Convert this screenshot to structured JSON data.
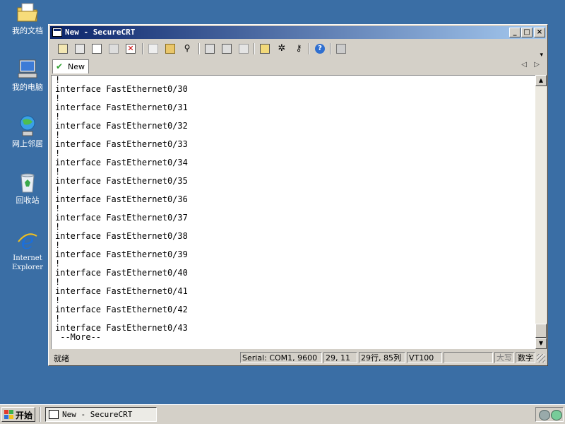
{
  "desktop": {
    "icons": [
      {
        "label": "我的文档",
        "icon": "folder-documents-icon"
      },
      {
        "label": "我的电脑",
        "icon": "computer-icon"
      },
      {
        "label": "网上邻居",
        "icon": "network-icon"
      },
      {
        "label": "回收站",
        "icon": "recycle-bin-icon"
      },
      {
        "label": "Internet Explorer",
        "icon": "internet-explorer-icon"
      }
    ]
  },
  "window": {
    "title": "New - SecureCRT",
    "caption_buttons": {
      "minimize": "_",
      "maximize": "□",
      "close": "×"
    },
    "toolbar_icons": [
      "connect-icon",
      "quick-connect-icon",
      "connect-in-tab-icon",
      "reconnect-icon",
      "disconnect-icon",
      "copy-icon",
      "paste-icon",
      "find-icon",
      "print-icon",
      "print-selection-icon",
      "print-screen-icon",
      "session-options-icon",
      "global-options-icon",
      "keymap-icon",
      "help-icon",
      "sftp-icon"
    ],
    "tab": {
      "label": "New",
      "status_icon": "checkmark-icon"
    },
    "terminal_lines": [
      "!",
      "interface FastEthernet0/30",
      "!",
      "interface FastEthernet0/31",
      "!",
      "interface FastEthernet0/32",
      "!",
      "interface FastEthernet0/33",
      "!",
      "interface FastEthernet0/34",
      "!",
      "interface FastEthernet0/35",
      "!",
      "interface FastEthernet0/36",
      "!",
      "interface FastEthernet0/37",
      "!",
      "interface FastEthernet0/38",
      "!",
      "interface FastEthernet0/39",
      "!",
      "interface FastEthernet0/40",
      "!",
      "interface FastEthernet0/41",
      "!",
      "interface FastEthernet0/42",
      "!",
      "interface FastEthernet0/43",
      " --More--"
    ],
    "status": {
      "state": "就绪",
      "connection": "Serial: COM1, 9600",
      "cursor": "29, 11",
      "size": "29行, 85列",
      "emulation": "VT100",
      "caps": "大写",
      "num": "数字"
    }
  },
  "taskbar": {
    "start_label": "开始",
    "task_title": "New - SecureCRT",
    "tray_icons": [
      "network-tray-icon",
      "volume-tray-icon"
    ]
  },
  "colors": {
    "desktop": "#3a6ea5",
    "title_active": "#0a246a",
    "chrome": "#d4d0c8"
  }
}
